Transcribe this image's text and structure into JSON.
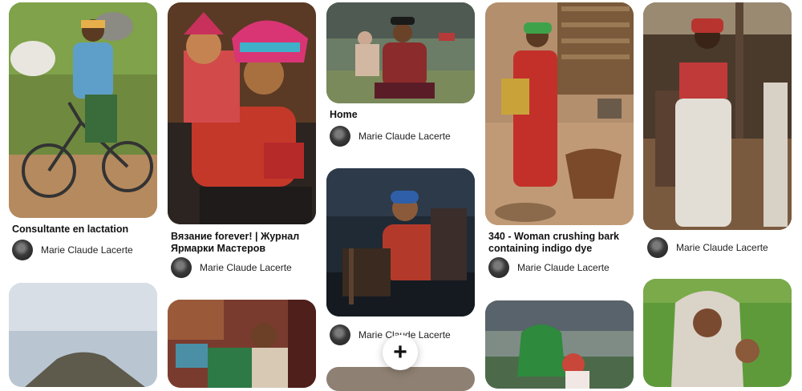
{
  "pins": [
    {
      "title": "Consultante en lactation",
      "user": "Marie Claude Lacerte"
    },
    {
      "title": "Вязание forever! | Журнал Ярмарки Мастеров",
      "user": "Marie Claude Lacerte"
    },
    {
      "title": "Home",
      "user": "Marie Claude Lacerte"
    },
    {
      "title": "",
      "user": "Marie Claude Lacerte"
    },
    {
      "title": "340 - Woman crushing bark containing indigo dye",
      "user": "Marie Claude Lacerte"
    },
    {
      "title": "",
      "user": "Marie Claude Lacerte"
    }
  ],
  "create_button": {
    "label": "+"
  },
  "icons": {
    "create": "plus-icon",
    "avatar": "user-avatar"
  }
}
